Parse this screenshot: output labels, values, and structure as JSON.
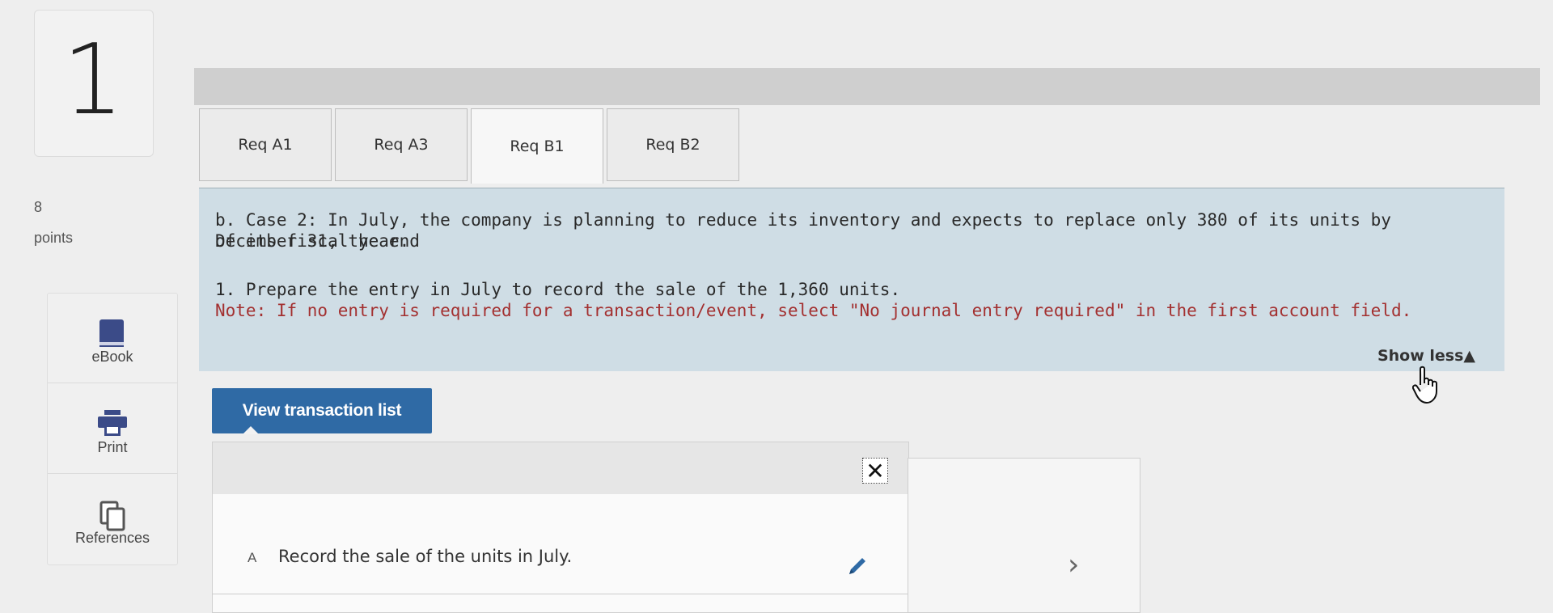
{
  "question": {
    "number": "1",
    "points_value": "8",
    "points_label": "points"
  },
  "sidebar": {
    "ebook_label": "eBook",
    "print_label": "Print",
    "references_label": "References",
    "icons": [
      "book-icon",
      "printer-icon",
      "copy-icon"
    ]
  },
  "tabs": [
    "Req A1",
    "Req A3",
    "Req B1",
    "Req B2"
  ],
  "active_tab": "Req B1",
  "requirement": {
    "line1": "b. Case 2: In July, the company is planning to reduce its inventory and expects to replace only 380 of its units by December 31, the end",
    "line2": "of its fiscal year.",
    "line3": "1. Prepare the entry in July to record the sale of the 1,360 units.",
    "note": "Note: If no entry is required for a transaction/event, select \"No journal entry required\" in the first account field.",
    "show_less": "Show less▲"
  },
  "transaction_button": "View transaction list",
  "transaction_row": {
    "letter": "A",
    "text": "Record the sale of the units in July."
  },
  "colors": {
    "accent": "#2f6aa5",
    "panel": "#cfdde5",
    "note": "#a33030"
  }
}
